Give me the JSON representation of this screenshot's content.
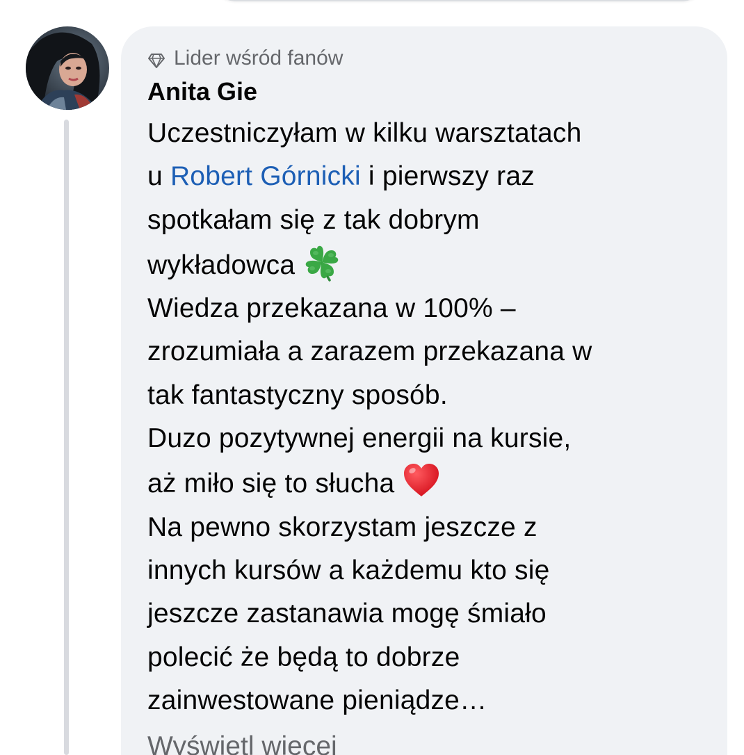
{
  "comment": {
    "badge": {
      "icon": "diamond-icon",
      "label": "Lider wśród fanów"
    },
    "author": "Anita Gie",
    "text": {
      "line1": "Uczestniczyłam w kilku warsztatach",
      "line2_prefix": "u",
      "mention": "Robert Górnicki",
      "line2_suffix": "i pierwszy raz",
      "line3": "spotkałam się z tak dobrym",
      "line4": "wykładowca",
      "line4_emoji": "four-leaf-clover-emoji",
      "line5": "Wiedza przekazana w 100% –",
      "line6": "zrozumiała a zarazem przekazana w",
      "line7": "tak fantastyczny sposób.",
      "line8": "Duzo pozytywnej energii na kursie,",
      "line9": "aż miło się to słucha",
      "line9_emoji": "red-heart-emoji",
      "line10": "Na pewno skorzystam jeszcze z",
      "line11": "innych kursów a każdemu kto się",
      "line12": "jeszcze zastanawia mogę śmiało",
      "line13": "polecić że będą to dobrze",
      "line14": "zainwestowane pieniądze…"
    },
    "see_more": "Wyświetl więcej"
  },
  "colors": {
    "bubble_bg": "#f0f2f5",
    "text": "#050505",
    "secondary_text": "#65676b",
    "mention": "#1d5fb5",
    "thread_line": "#d8dadf"
  }
}
